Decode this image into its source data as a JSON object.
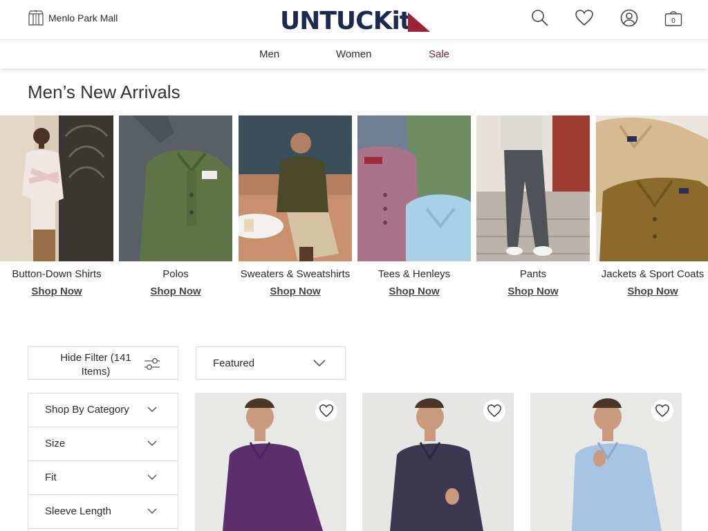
{
  "header": {
    "store_name": "Menlo Park Mall",
    "logo": "UNTUCKit",
    "icons": [
      "search-icon",
      "heart-icon",
      "account-icon",
      "bag-icon"
    ],
    "bag_count": "0"
  },
  "nav": {
    "items": [
      {
        "label": "Men"
      },
      {
        "label": "Women"
      },
      {
        "label": "Sale"
      }
    ]
  },
  "page": {
    "title": "Men’s New Arrivals"
  },
  "categories": [
    {
      "name": "Button-Down Shirts",
      "cta": "Shop Now"
    },
    {
      "name": "Polos",
      "cta": "Shop Now"
    },
    {
      "name": "Sweaters & Sweatshirts",
      "cta": "Shop Now"
    },
    {
      "name": "Tees & Henleys",
      "cta": "Shop Now"
    },
    {
      "name": "Pants",
      "cta": "Shop Now"
    },
    {
      "name": "Jackets & Sport Coats",
      "cta": "Shop Now"
    }
  ],
  "filter": {
    "label": "Hide Filter (141 Items)"
  },
  "sort": {
    "selected": "Featured"
  },
  "facets": [
    {
      "label": "Shop By Category"
    },
    {
      "label": "Size"
    },
    {
      "label": "Fit"
    },
    {
      "label": "Sleeve Length"
    }
  ],
  "colors": {
    "brand_navy": "#1b2a4e",
    "brand_red": "#9b2335",
    "sale_red": "#7d1f2b"
  }
}
